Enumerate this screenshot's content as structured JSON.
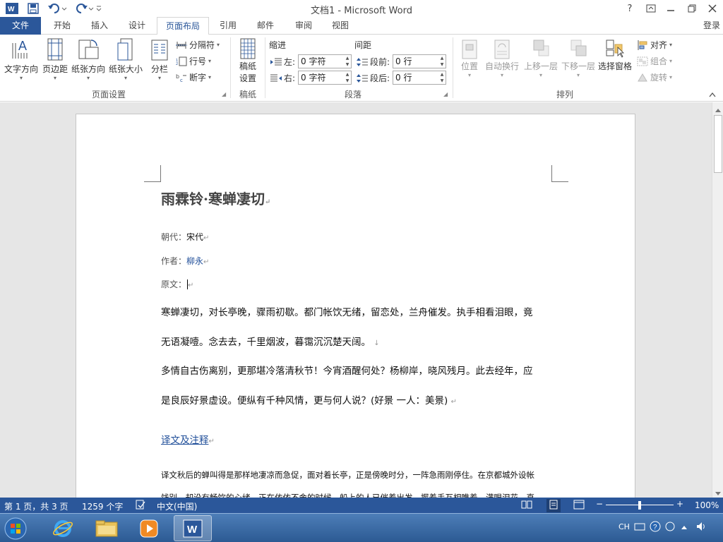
{
  "window": {
    "title": "文档1 - Microsoft Word",
    "help": "?",
    "colors": {
      "accent": "#2b579a",
      "link": "#1f4e99"
    }
  },
  "tabs": [
    {
      "label": "文件"
    },
    {
      "label": "开始"
    },
    {
      "label": "插入"
    },
    {
      "label": "设计"
    },
    {
      "label": "页面布局"
    },
    {
      "label": "引用"
    },
    {
      "label": "邮件"
    },
    {
      "label": "审阅"
    },
    {
      "label": "视图"
    }
  ],
  "login": "登录",
  "ribbon": {
    "page_setup": {
      "text_direction": "文字方向",
      "margins": "页边距",
      "orientation": "纸张方向",
      "size": "纸张大小",
      "columns": "分栏",
      "breaks": "分隔符",
      "line_numbers": "行号",
      "hyphenation": "断字",
      "group": "页面设置"
    },
    "manuscript": {
      "label_line1": "稿纸",
      "label_line2": "设置",
      "group": "稿纸"
    },
    "paragraph": {
      "indent": "缩进",
      "spacing": "间距",
      "left_label": "左:",
      "right_label": "右:",
      "before_label": "段前:",
      "after_label": "段后:",
      "left_value": "0 字符",
      "right_value": "0 字符",
      "before_value": "0 行",
      "after_value": "0 行",
      "group": "段落"
    },
    "arrange": {
      "position": "位置",
      "wrap_text": "自动换行",
      "bring_forward": "上移一层",
      "send_backward": "下移一层",
      "selection_pane": "选择窗格",
      "align": "对齐",
      "group_btn": "组合",
      "rotate": "旋转",
      "group": "排列"
    }
  },
  "document": {
    "title": "雨霖铃·寒蝉凄切",
    "dynasty_label": "朝代：",
    "dynasty": "宋代",
    "author_label": "作者：",
    "author": "柳永",
    "original_label": "原文：",
    "lines": [
      "寒蝉凄切，对长亭晚，骤雨初歇。都门帐饮无绪，留恋处，兰舟催发。执手相看泪眼，竟",
      "无语凝噎。念去去，千里烟波，暮霭沉沉楚天阔。",
      "多情自古伤离别，更那堪冷落清秋节！今宵酒醒何处？杨柳岸，晓风残月。此去经年，应",
      "是良辰好景虚设。便纵有千种风情，更与何人说？(好景 一人：美景)"
    ],
    "section_link": "译文及注释",
    "translation_line1": "译文秋后的蝉叫得是那样地凄凉而急促，面对着长亭，正是傍晚时分，一阵急雨刚停住。在京都城外设帐",
    "translation_line2": "饯别，却没有畅饮的心绪，正在依依不舍的时候，船上的人已催着出发。握着手互相瞧着，满眼泪花，直"
  },
  "status": {
    "page": "第 1 页，共 3 页",
    "words": "1259 个字",
    "language": "中文(中国)",
    "zoom": "100%",
    "zoom_fraction": 0.5
  },
  "taskbar": {
    "ime": "CH"
  }
}
